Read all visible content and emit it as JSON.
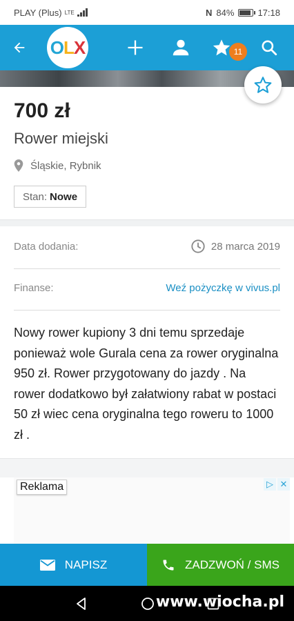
{
  "status_bar": {
    "carrier": "PLAY (Plus)",
    "network": "LTE",
    "battery": "84%",
    "time": "17:18"
  },
  "app_bar": {
    "logo_text": [
      "O",
      "L",
      "X"
    ],
    "favorites_count": "11"
  },
  "listing": {
    "price": "700 zł",
    "title": "Rower miejski",
    "location": "Śląskie, Rybnik",
    "condition_label": "Stan:",
    "condition_value": "Nowe"
  },
  "details": {
    "date_label": "Data dodania:",
    "date_value": "28 marca 2019",
    "finance_label": "Finanse:",
    "finance_link": "Weź pożyczkę w vivus.pl"
  },
  "description": "Nowy rower kupiony 3 dni temu sprzedaje ponieważ wole Gurala cena za rower oryginalna 950 zł. Rower przygotowany do jazdy . Na rower dodatkowo był załatwiony rabat w postaci 50 zł wiec cena oryginalna tego roweru to 1000 zł .",
  "ad": {
    "label": "Reklama"
  },
  "actions": {
    "write": "NAPISZ",
    "call": "ZADZWOŃ / SMS"
  },
  "watermark": "www.wiocha.pl",
  "colors": {
    "brand_blue": "#1c9fd6",
    "write_button": "#1497d3",
    "call_button": "#3aa51b",
    "badge": "#ee7e1e",
    "link": "#1a8fc4"
  }
}
